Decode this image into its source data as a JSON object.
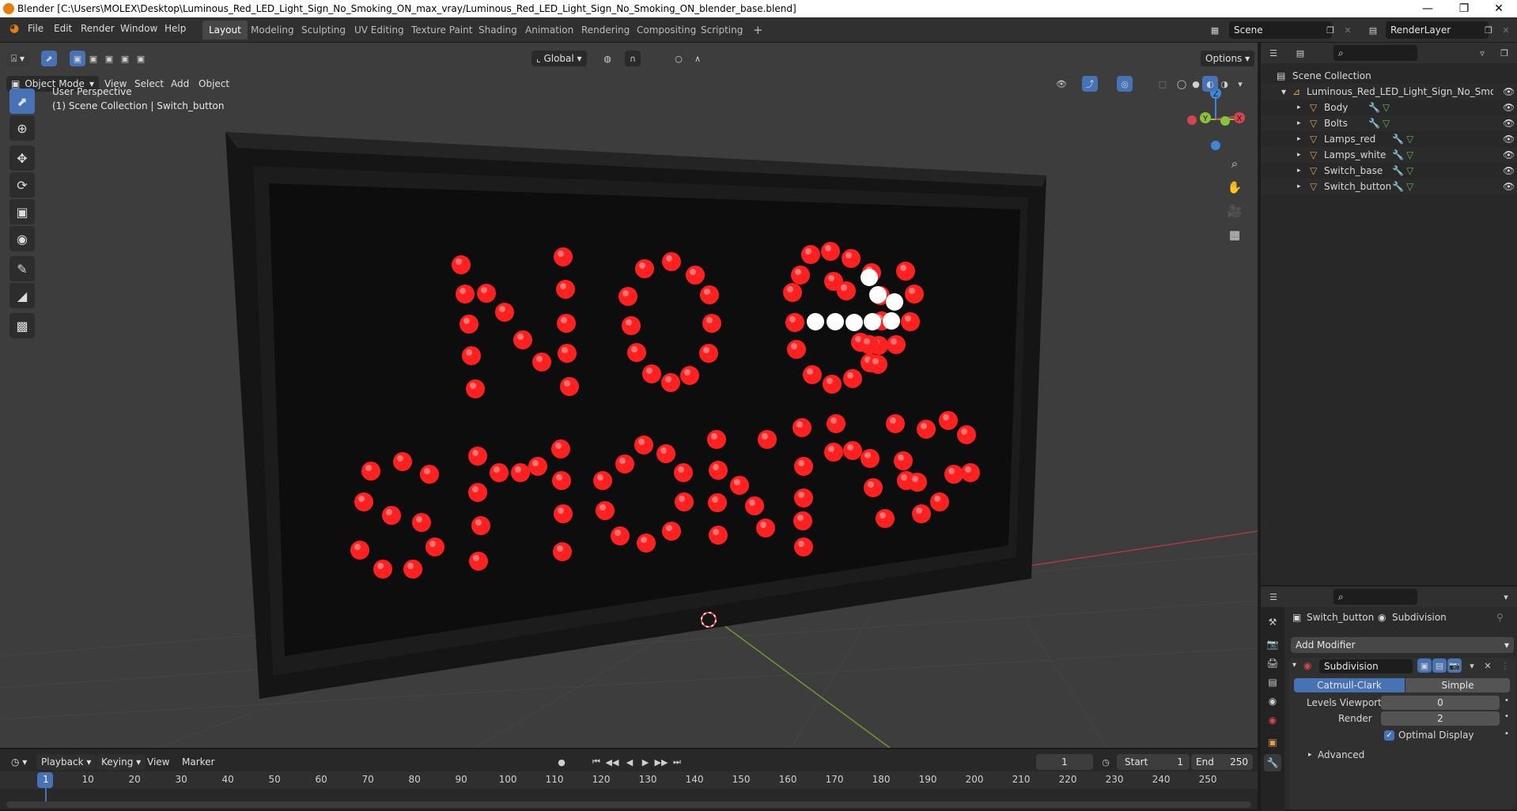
{
  "window": {
    "title": "Blender [C:\\Users\\MOLEX\\Desktop\\Luminous_Red_LED_Light_Sign_No_Smoking_ON_max_vray/Luminous_Red_LED_Light_Sign_No_Smoking_ON_blender_base.blend]"
  },
  "menu": [
    "File",
    "Edit",
    "Render",
    "Window",
    "Help"
  ],
  "workspaces": [
    "Layout",
    "Modeling",
    "Sculpting",
    "UV Editing",
    "Texture Paint",
    "Shading",
    "Animation",
    "Rendering",
    "Compositing",
    "Scripting"
  ],
  "active_workspace": "Layout",
  "scene": {
    "name": "Scene",
    "render_layer": "RenderLayer"
  },
  "viewport": {
    "mode": "Object Mode",
    "header_menus": [
      "View",
      "Select",
      "Add",
      "Object"
    ],
    "transform_orientation": "Global",
    "options_label": "Options",
    "overlay_title": "User Perspective",
    "overlay_subtitle": "(1) Scene Collection | Switch_button",
    "gizmo_axes": {
      "z": "Z",
      "y": "Y",
      "x": "X"
    }
  },
  "outliner": {
    "root": "Scene Collection",
    "collection": "Luminous_Red_LED_Light_Sign_No_Smoking",
    "objects": [
      "Body",
      "Bolts",
      "Lamps_red",
      "Lamps_white",
      "Switch_base",
      "Switch_button"
    ]
  },
  "properties": {
    "object_name": "Switch_button",
    "modifier_crumb": "Subdivision",
    "add_modifier": "Add Modifier",
    "modifier_name": "Subdivision",
    "mode_options": [
      "Catmull-Clark",
      "Simple"
    ],
    "levels_viewport_label": "Levels Viewport",
    "levels_viewport": "0",
    "render_label": "Render",
    "render_value": "2",
    "optimal_display": "Optimal Display",
    "advanced": "Advanced"
  },
  "timeline": {
    "menus": [
      "Playback",
      "Keying",
      "View",
      "Marker"
    ],
    "current_frame": "1",
    "start_label": "Start",
    "start": "1",
    "end_label": "End",
    "end": "250",
    "ticks": [
      "1",
      "10",
      "20",
      "30",
      "40",
      "50",
      "60",
      "70",
      "80",
      "90",
      "100",
      "110",
      "120",
      "130",
      "140",
      "150",
      "160",
      "170",
      "180",
      "190",
      "200",
      "210",
      "220",
      "230",
      "240",
      "250"
    ]
  },
  "colors": {
    "accent": "#4772b3",
    "led_red": "#ff2020",
    "led_white": "#ffffff",
    "axis_x": "#d5454f",
    "axis_y": "#8ac23a",
    "axis_z": "#3f86d9"
  }
}
